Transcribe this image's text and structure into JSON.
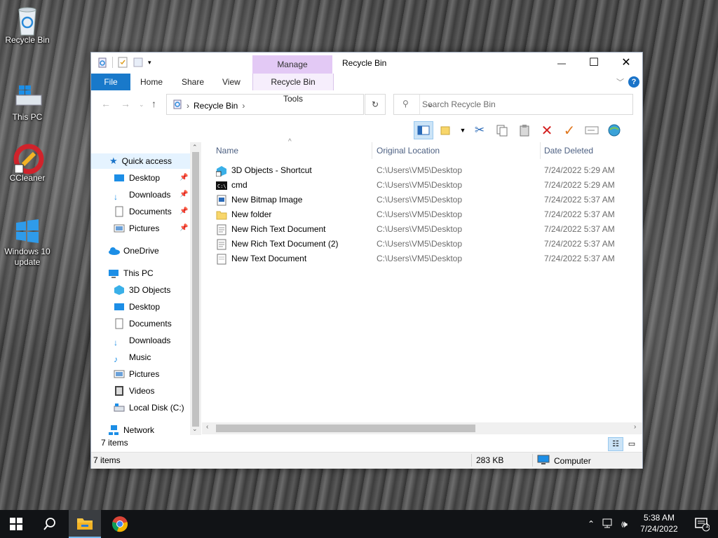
{
  "desktop": {
    "icons": [
      {
        "label": "Recycle Bin"
      },
      {
        "label": "This PC"
      },
      {
        "label": "CCleaner"
      },
      {
        "label": "Windows 10 update"
      }
    ]
  },
  "window": {
    "title": "Recycle Bin",
    "manage_tab": "Manage",
    "tabs": {
      "file": "File",
      "home": "Home",
      "share": "Share",
      "view": "View",
      "tools": "Recycle Bin Tools"
    },
    "caption": {
      "minimize": "—",
      "maximize": "☐",
      "close": "✕"
    },
    "help": "?"
  },
  "address": {
    "breadcrumb": [
      "Recycle Bin"
    ],
    "search_placeholder": "Search Recycle Bin"
  },
  "nav": {
    "quick_access": "Quick access",
    "qa_items": [
      "Desktop",
      "Downloads",
      "Documents",
      "Pictures"
    ],
    "onedrive": "OneDrive",
    "this_pc": "This PC",
    "pc_items": [
      "3D Objects",
      "Desktop",
      "Documents",
      "Downloads",
      "Music",
      "Pictures",
      "Videos",
      "Local Disk (C:)"
    ],
    "network": "Network"
  },
  "list": {
    "columns": {
      "name": "Name",
      "location": "Original Location",
      "date": "Date Deleted"
    },
    "rows": [
      {
        "name": "3D Objects - Shortcut",
        "location": "C:\\Users\\VM5\\Desktop",
        "date": "7/24/2022 5:29 AM",
        "icon": "shortcut-icon"
      },
      {
        "name": "cmd",
        "location": "C:\\Users\\VM5\\Desktop",
        "date": "7/24/2022 5:29 AM",
        "icon": "cmd-icon"
      },
      {
        "name": "New Bitmap Image",
        "location": "C:\\Users\\VM5\\Desktop",
        "date": "7/24/2022 5:37 AM",
        "icon": "bitmap-icon"
      },
      {
        "name": "New folder",
        "location": "C:\\Users\\VM5\\Desktop",
        "date": "7/24/2022 5:37 AM",
        "icon": "folder-icon"
      },
      {
        "name": "New Rich Text Document",
        "location": "C:\\Users\\VM5\\Desktop",
        "date": "7/24/2022 5:37 AM",
        "icon": "document-icon"
      },
      {
        "name": "New Rich Text Document (2)",
        "location": "C:\\Users\\VM5\\Desktop",
        "date": "7/24/2022 5:37 AM",
        "icon": "document-icon"
      },
      {
        "name": "New Text Document",
        "location": "C:\\Users\\VM5\\Desktop",
        "date": "7/24/2022 5:37 AM",
        "icon": "text-file-icon"
      }
    ]
  },
  "bottom": {
    "count": "7 items"
  },
  "status": {
    "items": "7 items",
    "size": "283 KB",
    "computer": "Computer"
  },
  "taskbar": {
    "time": "5:38 AM",
    "date": "7/24/2022",
    "notif_count": "1"
  },
  "colors": {
    "accent": "#1979ca",
    "manage": "#e3c9f5",
    "taskbar": "#111316"
  }
}
